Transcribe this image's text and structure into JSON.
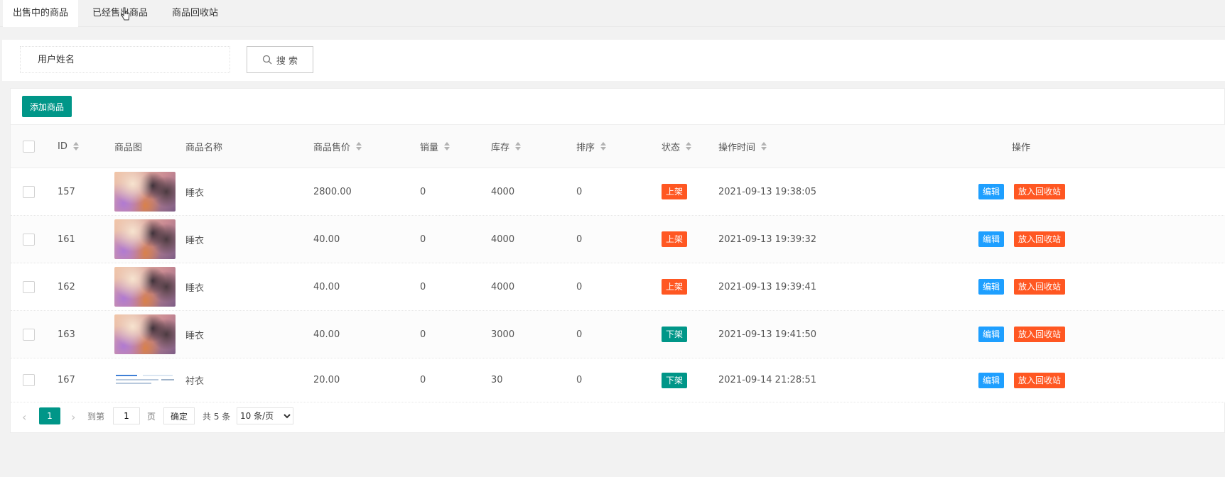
{
  "tabs": [
    "出售中的商品",
    "已经售出商品",
    "商品回收站"
  ],
  "search": {
    "placeholder": "用户姓名",
    "button": "搜 索"
  },
  "toolbar": {
    "add_label": "添加商品"
  },
  "table": {
    "headers": {
      "id": "ID",
      "image": "商品图",
      "name": "商品名称",
      "price": "商品售价",
      "sales": "销量",
      "stock": "库存",
      "order": "排序",
      "status": "状态",
      "time": "操作时间",
      "ops": "操作"
    },
    "rows": [
      {
        "id": "157",
        "name": "睡衣",
        "price": "2800.00",
        "sales": "0",
        "stock": "4000",
        "order": "0",
        "status": "上架",
        "time": "2021-09-13 19:38:05",
        "image": "photo"
      },
      {
        "id": "161",
        "name": "睡衣",
        "price": "40.00",
        "sales": "0",
        "stock": "4000",
        "order": "0",
        "status": "上架",
        "time": "2021-09-13 19:39:32",
        "image": "photo"
      },
      {
        "id": "162",
        "name": "睡衣",
        "price": "40.00",
        "sales": "0",
        "stock": "4000",
        "order": "0",
        "status": "上架",
        "time": "2021-09-13 19:39:41",
        "image": "photo"
      },
      {
        "id": "163",
        "name": "睡衣",
        "price": "40.00",
        "sales": "0",
        "stock": "3000",
        "order": "0",
        "status": "下架",
        "time": "2021-09-13 19:41:50",
        "image": "photo"
      },
      {
        "id": "167",
        "name": "衬衣",
        "price": "20.00",
        "sales": "0",
        "stock": "30",
        "order": "0",
        "status": "下架",
        "time": "2021-09-14 21:28:51",
        "image": "screenshot"
      }
    ],
    "actions": {
      "edit": "编辑",
      "recycle": "放入回收站"
    }
  },
  "pager": {
    "current": "1",
    "goto_label": "到第",
    "page_value": "1",
    "page_unit": "页",
    "confirm": "确定",
    "total": "共 5 条",
    "per_page": "10 条/页"
  },
  "colors": {
    "primary": "#009688",
    "on_shelf": "#ff5722",
    "off_shelf": "#009688",
    "edit": "#1e9fff",
    "recycle": "#ff5722"
  }
}
